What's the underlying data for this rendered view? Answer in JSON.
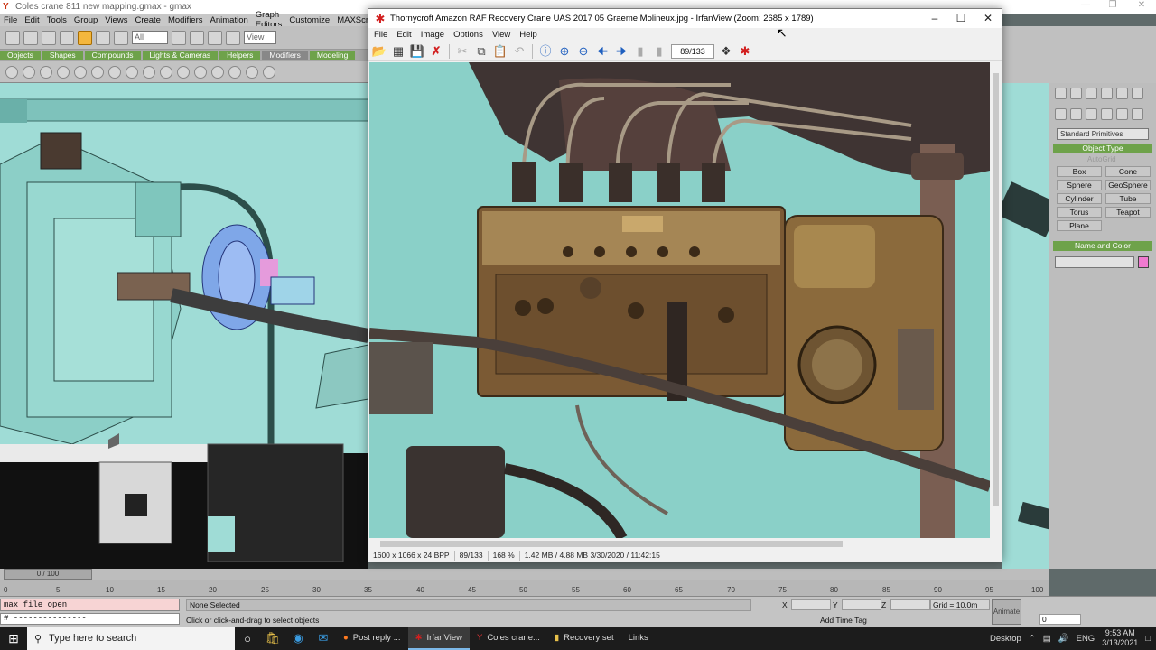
{
  "gmax": {
    "window_title": "Coles crane 811 new mapping.gmax - gmax",
    "menu": [
      "File",
      "Edit",
      "Tools",
      "Group",
      "Views",
      "Create",
      "Modifiers",
      "Animation",
      "Graph Editors",
      "Customize",
      "MAXScript"
    ],
    "toolbar": {
      "selection_filter": "All",
      "ref_coord": "View"
    },
    "tabs": [
      "Objects",
      "Shapes",
      "Compounds",
      "Lights & Cameras",
      "Helpers",
      "Modifiers",
      "Modeling"
    ],
    "command_panel": {
      "primitive_type": "Standard Primitives",
      "object_type_title": "Object Type",
      "autogrid_label": "AutoGrid",
      "buttons": [
        "Box",
        "Cone",
        "Sphere",
        "GeoSphere",
        "Cylinder",
        "Tube",
        "Torus",
        "Teapot",
        "Plane"
      ],
      "name_color_title": "Name and Color",
      "object_color": "#f07ad0"
    },
    "timeline": {
      "slider_label": "0 / 100"
    },
    "ruler_ticks": [
      "0",
      "5",
      "10",
      "15",
      "20",
      "25",
      "30",
      "35",
      "40",
      "45",
      "50",
      "55",
      "60",
      "65",
      "70",
      "75",
      "80",
      "85",
      "90",
      "95",
      "100"
    ],
    "status": {
      "maxscript_line1": "max file open",
      "maxscript_line2": "# ---------------",
      "selection": "None Selected",
      "prompt": "Click or click-and-drag to select objects",
      "x_label": "X",
      "y_label": "Y",
      "z_label": "Z",
      "grid": "Grid = 10.0m",
      "add_time_tag": "Add Time Tag",
      "animate": "Animate",
      "frame": "0"
    },
    "viewport_color": "#9fdcd6"
  },
  "irfanview": {
    "window_title": "Thornycroft Amazon RAF Recovery Crane UAS 2017 05 Graeme Molineux.jpg - IrfanView (Zoom: 2685 x 1789)",
    "menu": [
      "File",
      "Edit",
      "Image",
      "Options",
      "View",
      "Help"
    ],
    "page_indicator": "89/133",
    "toolbar_icons": [
      "open-icon",
      "thumbnails-icon",
      "save-icon",
      "delete-icon",
      "cut-icon",
      "copy-icon",
      "paste-icon",
      "undo-icon",
      "info-icon",
      "zoom-in-icon",
      "zoom-out-icon",
      "previous-icon",
      "next-icon",
      "first-page-icon",
      "last-page-icon",
      "settings-icon",
      "exit-icon"
    ],
    "status": {
      "dimensions": "1600 x 1066 x 24 BPP",
      "index": "89/133",
      "zoom": "168 %",
      "size_date": "1.42 MB / 4.88 MB 3/30/2020 / 11:42:15"
    }
  },
  "taskbar": {
    "search_placeholder": "Type here to search",
    "apps": [
      {
        "label": "Post reply ...",
        "icon": "firefox-icon",
        "active": false
      },
      {
        "label": "IrfanView",
        "icon": "irfanview-icon",
        "active": true
      },
      {
        "label": "Coles crane...",
        "icon": "gmax-icon",
        "active": false
      },
      {
        "label": "Recovery set",
        "icon": "folder-icon",
        "active": false
      },
      {
        "label": "Links",
        "icon": "",
        "active": false
      }
    ],
    "tray": {
      "desktop_label": "Desktop",
      "language": "ENG",
      "time": "9:53 AM",
      "date": "3/13/2021"
    }
  }
}
